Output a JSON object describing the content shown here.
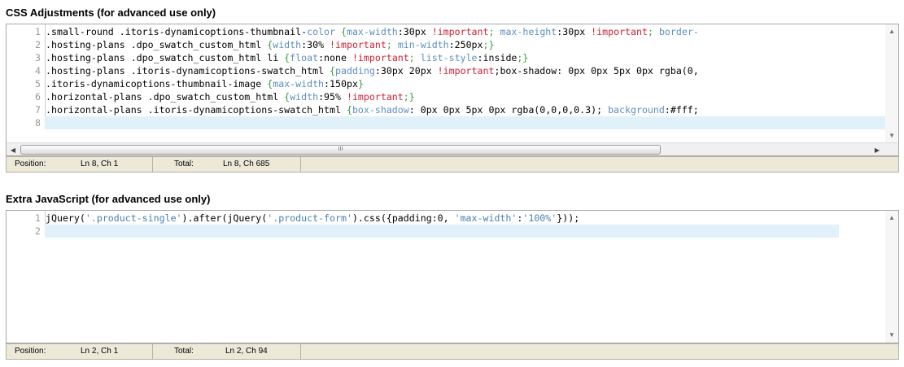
{
  "css_section": {
    "title": "CSS Adjustments (for advanced use only)",
    "lines": [
      {
        "num": "1",
        "segments": [
          {
            "t": ".small-round .itoris-dynamicoptions-thumbnail-",
            "c": ""
          },
          {
            "t": "color",
            "c": "prop"
          },
          {
            "t": " ",
            "c": ""
          },
          {
            "t": "{",
            "c": "punc"
          },
          {
            "t": "max-width",
            "c": "prop"
          },
          {
            "t": ":30px ",
            "c": ""
          },
          {
            "t": "!important",
            "c": "imp"
          },
          {
            "t": "; ",
            "c": "punc"
          },
          {
            "t": "max-height",
            "c": "prop"
          },
          {
            "t": ":30px ",
            "c": ""
          },
          {
            "t": "!important",
            "c": "imp"
          },
          {
            "t": "; ",
            "c": "punc"
          },
          {
            "t": "border-",
            "c": "prop"
          }
        ]
      },
      {
        "num": "2",
        "segments": [
          {
            "t": ".hosting-plans .dpo_swatch_custom_html ",
            "c": ""
          },
          {
            "t": "{",
            "c": "punc"
          },
          {
            "t": "width",
            "c": "prop"
          },
          {
            "t": ":30% ",
            "c": ""
          },
          {
            "t": "!important",
            "c": "imp"
          },
          {
            "t": "; ",
            "c": "punc"
          },
          {
            "t": "min-width",
            "c": "prop"
          },
          {
            "t": ":250px",
            "c": ""
          },
          {
            "t": ";}",
            "c": "punc"
          }
        ]
      },
      {
        "num": "3",
        "segments": [
          {
            "t": ".hosting-plans .dpo_swatch_custom_html li ",
            "c": ""
          },
          {
            "t": "{",
            "c": "punc"
          },
          {
            "t": "float",
            "c": "prop"
          },
          {
            "t": ":none ",
            "c": ""
          },
          {
            "t": "!important",
            "c": "imp"
          },
          {
            "t": "; ",
            "c": "punc"
          },
          {
            "t": "list-style",
            "c": "prop"
          },
          {
            "t": ":inside",
            "c": ""
          },
          {
            "t": ";}",
            "c": "punc"
          }
        ]
      },
      {
        "num": "4",
        "segments": [
          {
            "t": ".hosting-plans .itoris-dynamicoptions-swatch_html ",
            "c": ""
          },
          {
            "t": "{",
            "c": "punc"
          },
          {
            "t": "padding",
            "c": "prop"
          },
          {
            "t": ":30px 20px ",
            "c": ""
          },
          {
            "t": "!important",
            "c": "imp"
          },
          {
            "t": ";box-shadow: 0px 0px 5px 0px rgba(0,",
            "c": ""
          }
        ]
      },
      {
        "num": "5",
        "segments": [
          {
            "t": ".itoris-dynamicoptions-thumbnail-image ",
            "c": ""
          },
          {
            "t": "{",
            "c": "punc"
          },
          {
            "t": "max-width",
            "c": "prop"
          },
          {
            "t": ":150px",
            "c": ""
          },
          {
            "t": "}",
            "c": "punc"
          }
        ]
      },
      {
        "num": "6",
        "segments": [
          {
            "t": ".horizontal-plans .dpo_swatch_custom_html ",
            "c": ""
          },
          {
            "t": "{",
            "c": "punc"
          },
          {
            "t": "width",
            "c": "prop"
          },
          {
            "t": ":95% ",
            "c": ""
          },
          {
            "t": "!important",
            "c": "imp"
          },
          {
            "t": ";}",
            "c": "punc"
          }
        ]
      },
      {
        "num": "7",
        "segments": [
          {
            "t": ".horizontal-plans .itoris-dynamicoptions-swatch_html ",
            "c": ""
          },
          {
            "t": "{",
            "c": "punc"
          },
          {
            "t": "box-shadow",
            "c": "prop"
          },
          {
            "t": ": 0px 0px 5px 0px rgba(0,0,0,0.3); ",
            "c": ""
          },
          {
            "t": "background",
            "c": "prop"
          },
          {
            "t": ":#fff;",
            "c": ""
          }
        ]
      },
      {
        "num": "8",
        "segments": []
      }
    ],
    "status": {
      "position_label": "Position:",
      "position_value": "Ln 8, Ch 1",
      "total_label": "Total:",
      "total_value": "Ln 8, Ch 685"
    },
    "hscroll_grip": "III"
  },
  "js_section": {
    "title": "Extra JavaScript (for advanced use only)",
    "lines": [
      {
        "num": "1",
        "segments": [
          {
            "t": "jQuery(",
            "c": ""
          },
          {
            "t": "'.product-single'",
            "c": "str"
          },
          {
            "t": ").after(jQuery(",
            "c": ""
          },
          {
            "t": "'.product-form'",
            "c": "str"
          },
          {
            "t": ").css({padding:0, ",
            "c": ""
          },
          {
            "t": "'max-width'",
            "c": "str"
          },
          {
            "t": ":",
            "c": ""
          },
          {
            "t": "'100%'",
            "c": "str"
          },
          {
            "t": "}));",
            "c": ""
          }
        ]
      },
      {
        "num": "2",
        "segments": []
      }
    ],
    "status": {
      "position_label": "Position:",
      "position_value": "Ln 2, Ch 1",
      "total_label": "Total:",
      "total_value": "Ln 2, Ch 94"
    }
  },
  "icons": {
    "scroll_up": "scroll-up-arrow-icon",
    "scroll_down": "scroll-down-arrow-icon",
    "scroll_left": "scroll-left-arrow-icon",
    "scroll_right": "scroll-right-arrow-icon"
  }
}
